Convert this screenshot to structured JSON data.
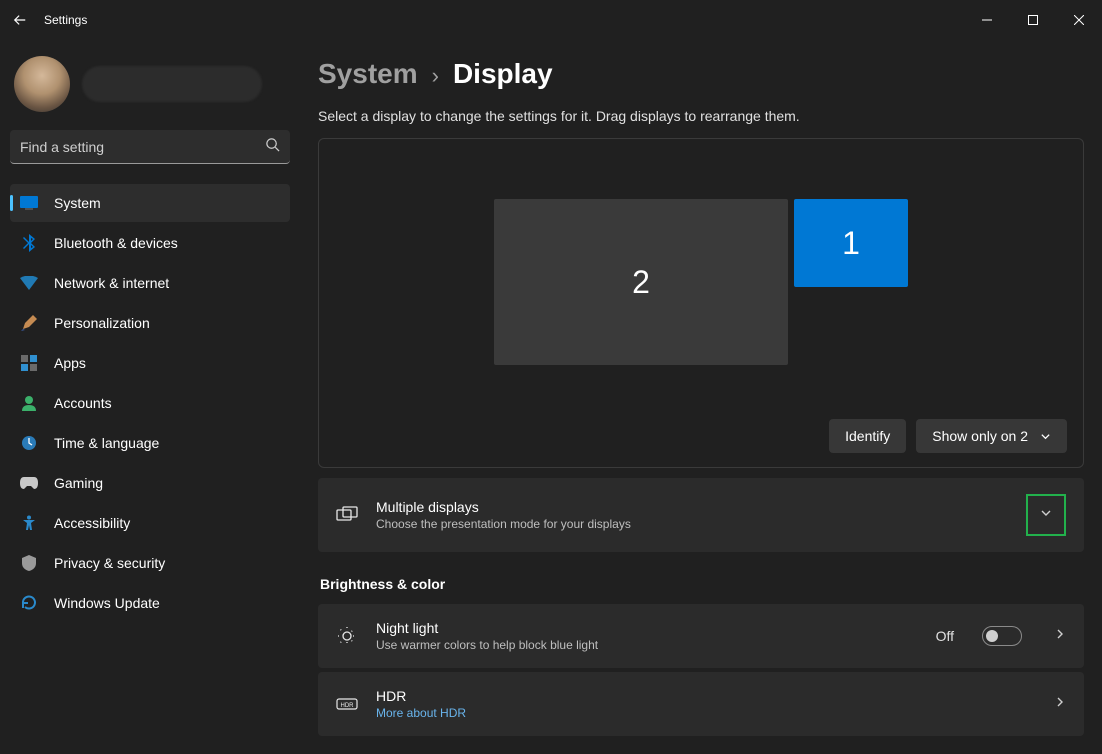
{
  "window": {
    "title": "Settings"
  },
  "search": {
    "placeholder": "Find a setting"
  },
  "sidebar": {
    "items": [
      {
        "label": "System",
        "name": "system",
        "active": true
      },
      {
        "label": "Bluetooth & devices",
        "name": "bluetooth-devices"
      },
      {
        "label": "Network & internet",
        "name": "network-internet"
      },
      {
        "label": "Personalization",
        "name": "personalization"
      },
      {
        "label": "Apps",
        "name": "apps"
      },
      {
        "label": "Accounts",
        "name": "accounts"
      },
      {
        "label": "Time & language",
        "name": "time-language"
      },
      {
        "label": "Gaming",
        "name": "gaming"
      },
      {
        "label": "Accessibility",
        "name": "accessibility"
      },
      {
        "label": "Privacy & security",
        "name": "privacy-security"
      },
      {
        "label": "Windows Update",
        "name": "windows-update"
      }
    ]
  },
  "breadcrumb": {
    "parent": "System",
    "current": "Display"
  },
  "subtitle": "Select a display to change the settings for it. Drag displays to rearrange them.",
  "monitors": {
    "primary": "1",
    "secondary": "2"
  },
  "arrange": {
    "identify": "Identify",
    "mode": "Show only on 2"
  },
  "multiple_displays": {
    "title": "Multiple displays",
    "sub": "Choose the presentation mode for your displays"
  },
  "section1": "Brightness & color",
  "night_light": {
    "title": "Night light",
    "sub": "Use warmer colors to help block blue light",
    "state": "Off"
  },
  "hdr": {
    "title": "HDR",
    "link": "More about HDR"
  }
}
